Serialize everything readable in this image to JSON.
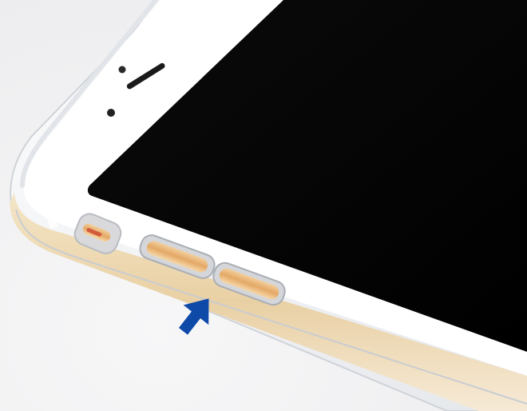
{
  "scene": {
    "subject": "smartphone-in-clear-case",
    "colors": {
      "background": "#f0f0f2",
      "phone_frame": "#ffffff",
      "screen": "#050505",
      "gold_edge": "#e8cfa0",
      "button_gold": "#e6b47a",
      "arrow": "#0f4aa8"
    },
    "icons": {
      "pointer": "arrow-up-right-icon"
    }
  }
}
